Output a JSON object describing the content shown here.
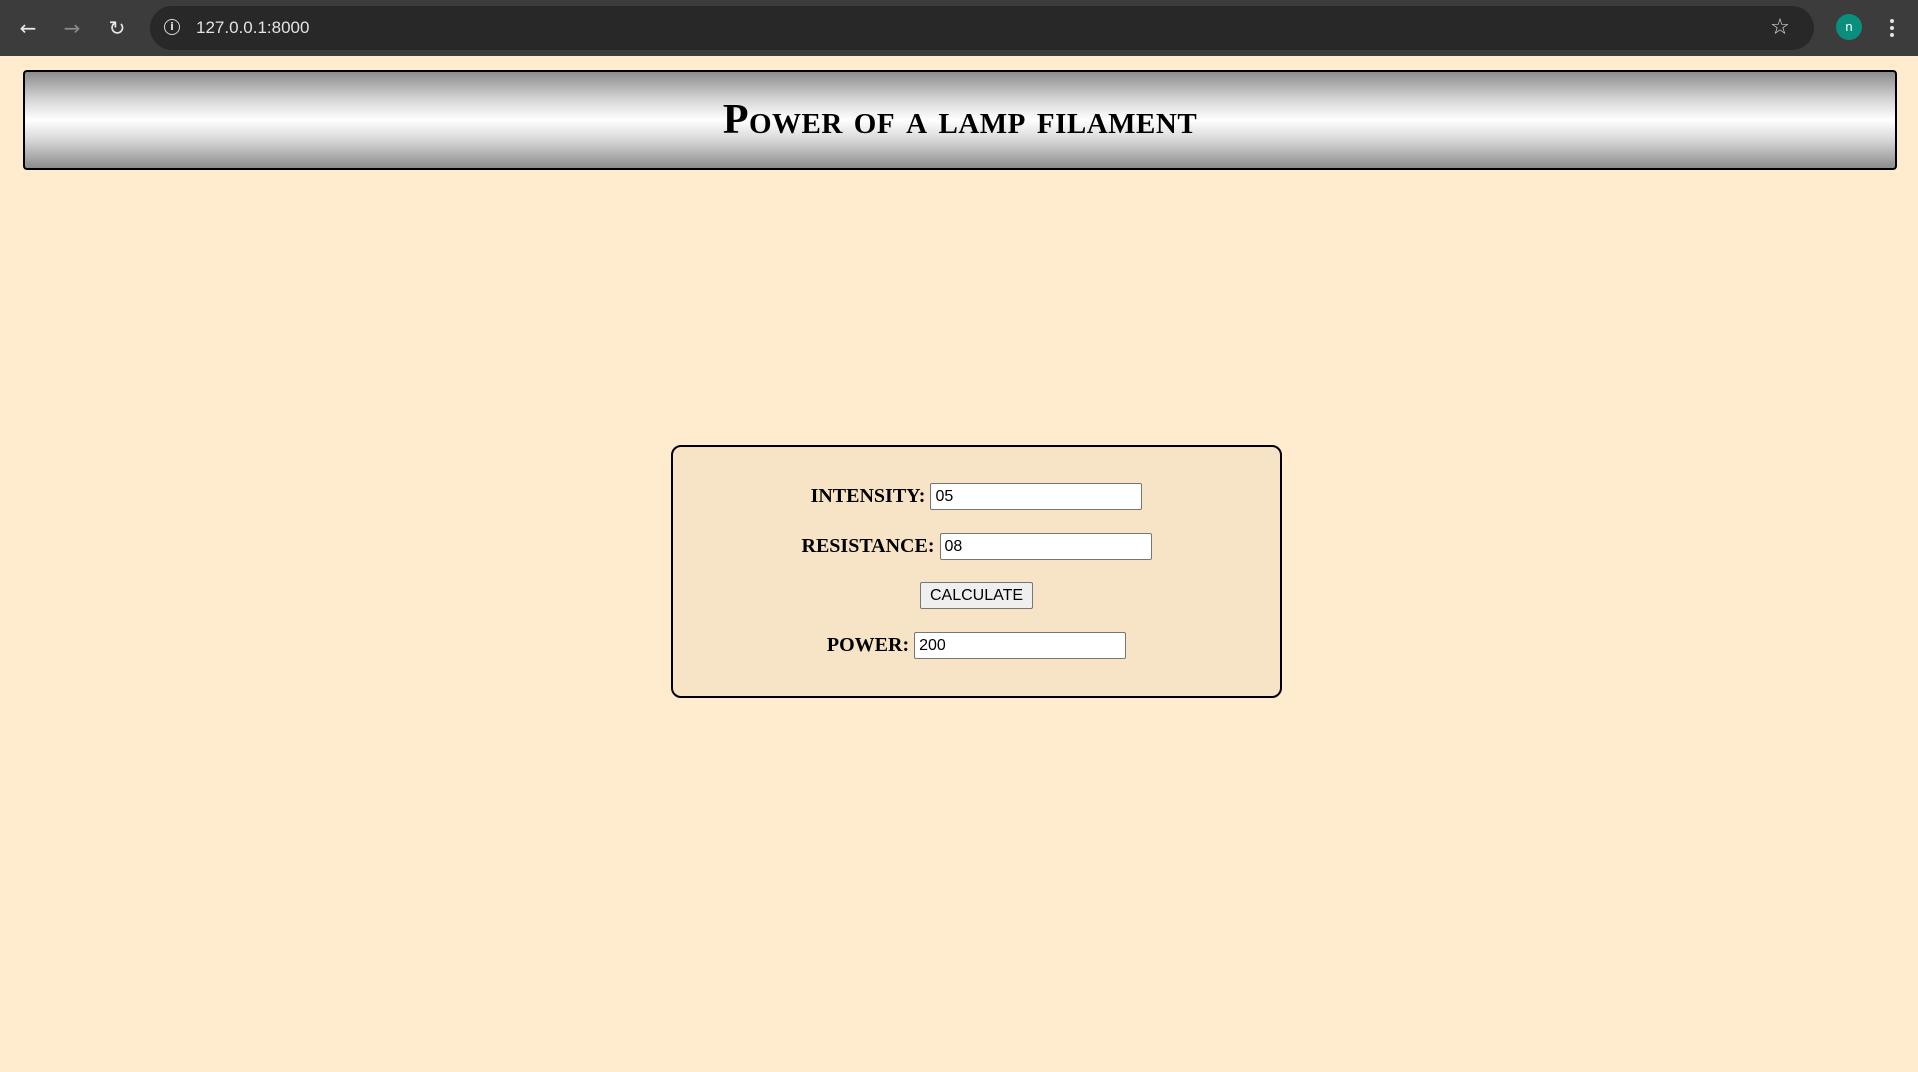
{
  "browser": {
    "url": "127.0.0.1:8000",
    "back_icon": "arrow-left-icon",
    "forward_icon": "arrow-right-icon",
    "reload_icon": "reload-icon",
    "avatar_letter": "n",
    "avatar_color": "#0a8f7e"
  },
  "page": {
    "title": "Power of a lamp filament",
    "background_color": "#ffebcd"
  },
  "form": {
    "intensity_label": "INTENSITY:",
    "intensity_value": "05",
    "resistance_label": "RESISTANCE:",
    "resistance_value": "08",
    "calculate_label": "CALCULATE",
    "power_label": "POWER:",
    "power_value": "200"
  }
}
